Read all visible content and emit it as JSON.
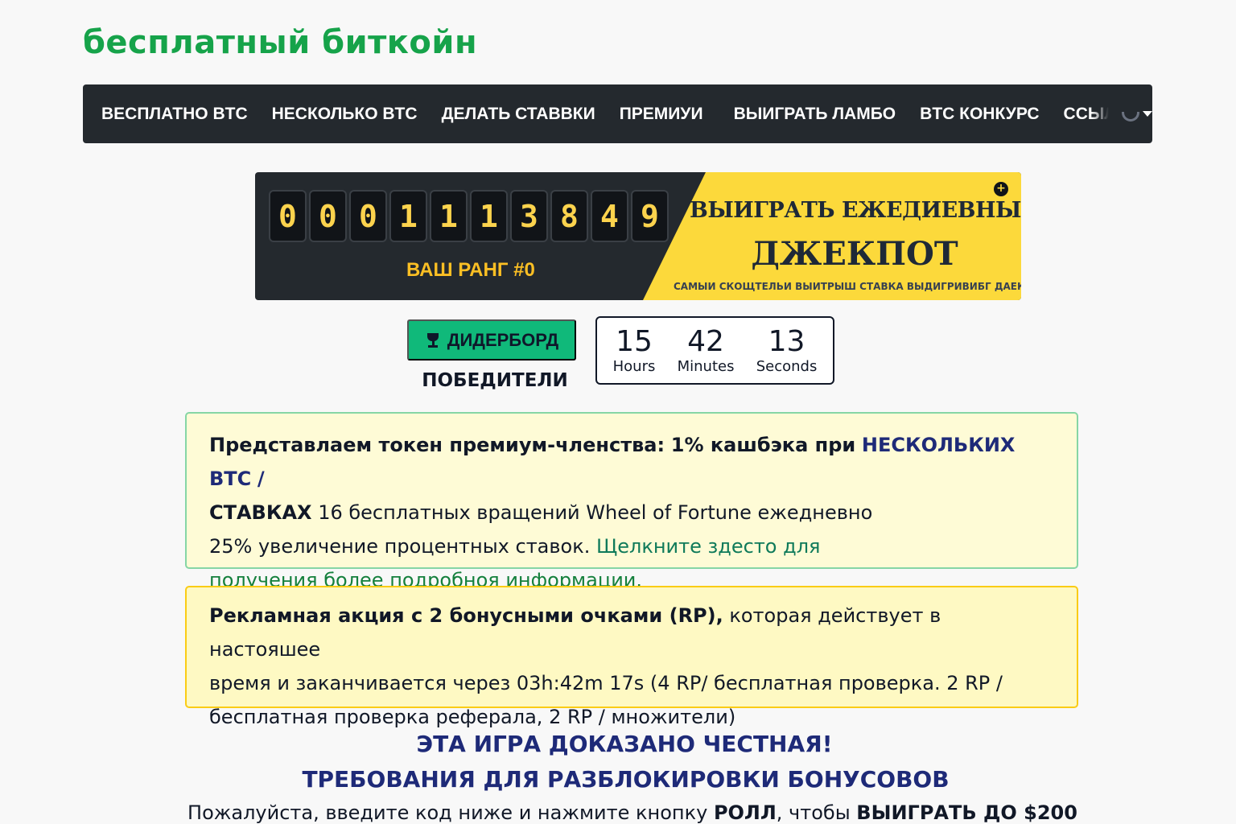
{
  "site": {
    "logo": "бесплатный биткойн"
  },
  "nav": {
    "items": [
      "ВЕСПЛАТНО BTC",
      "НЕСКОЛЬКО BTC",
      "ДЕЛАТЬ СТАВВКИ",
      "ПРЕМИУИ",
      "ВЫИГРАТЬ ЛАМБО",
      "BTC КОНКУРС",
      "ССЫЛАТ"
    ]
  },
  "jackpot": {
    "digits": [
      "0",
      "0",
      "0",
      "1",
      "1",
      "1",
      "3",
      "8",
      "4",
      "9"
    ],
    "rank": "ВАШ РАНГ #0",
    "title_line1": "ВЫИГРАТЬ ЕЖЕДИЕВНЫЙ",
    "title_line2": "ДЖЕКПОТ",
    "subtitle": "САМЫИ СКОЩТЕЛЬИ ВЫИТРЫШ СТАВКА ВЫДИГРИВИБГ ДАЕКЛОТ",
    "info_icon": "+"
  },
  "leaderboard": {
    "button_label": "ДИДЕРБОРД",
    "winners_label": "ПОБЕДИТЕЛИ"
  },
  "countdown": {
    "hours": "15",
    "hours_label": "Hours",
    "minutes": "42",
    "minutes_label": "Minutes",
    "seconds": "13",
    "seconds_label": "Seconds"
  },
  "premium": {
    "intro": "Представлаем токен премиум-членства:",
    "cashback": "1% кашбэка при",
    "multi_btc": "НЕСКОЛЬКИХ BTC",
    "slash": "/",
    "bets": "СТАВКАХ",
    "spins": "16 бесплатных вращений Wheel of Fortune ежедневно",
    "interest": "25% увеличение процентных ставок.",
    "link_part1": "Щелкните здесто для",
    "link_part2": "получения более подробноя информации."
  },
  "promo": {
    "bold_part": "Рекламная акция с 2 бонусными очками (RP),",
    "rest_line1": "которая действует в настояшее",
    "line2": "время и заканчивается через 03h:42m 17s (4 RP/ бесплатная проверка. 2 RP /",
    "line3": "бесплатная проверка реферала, 2 RP / множители)"
  },
  "fair": {
    "title": "ЭТА ИГРА ДОКАЗАНО ЧЕСТНАЯ!",
    "subtitle": "ТРЕБОВАНИЯ ДЛЯ РАЗБЛОКИРОВКИ БОНУСОВОВ",
    "roll_text_start": "Пожалуйста, введите код ниже и нажмите кнопку",
    "roll_word": "РОЛЛ",
    "roll_text_mid": ", чтобы",
    "roll_win": "ВЫИГРАТЬ ДО $200"
  },
  "colors": {
    "brand_green": "#16a34a",
    "nav_bg": "#24292e",
    "jackpot_yellow": "#fcd93b",
    "button_green": "#10b97a",
    "navy": "#1e2a78"
  }
}
